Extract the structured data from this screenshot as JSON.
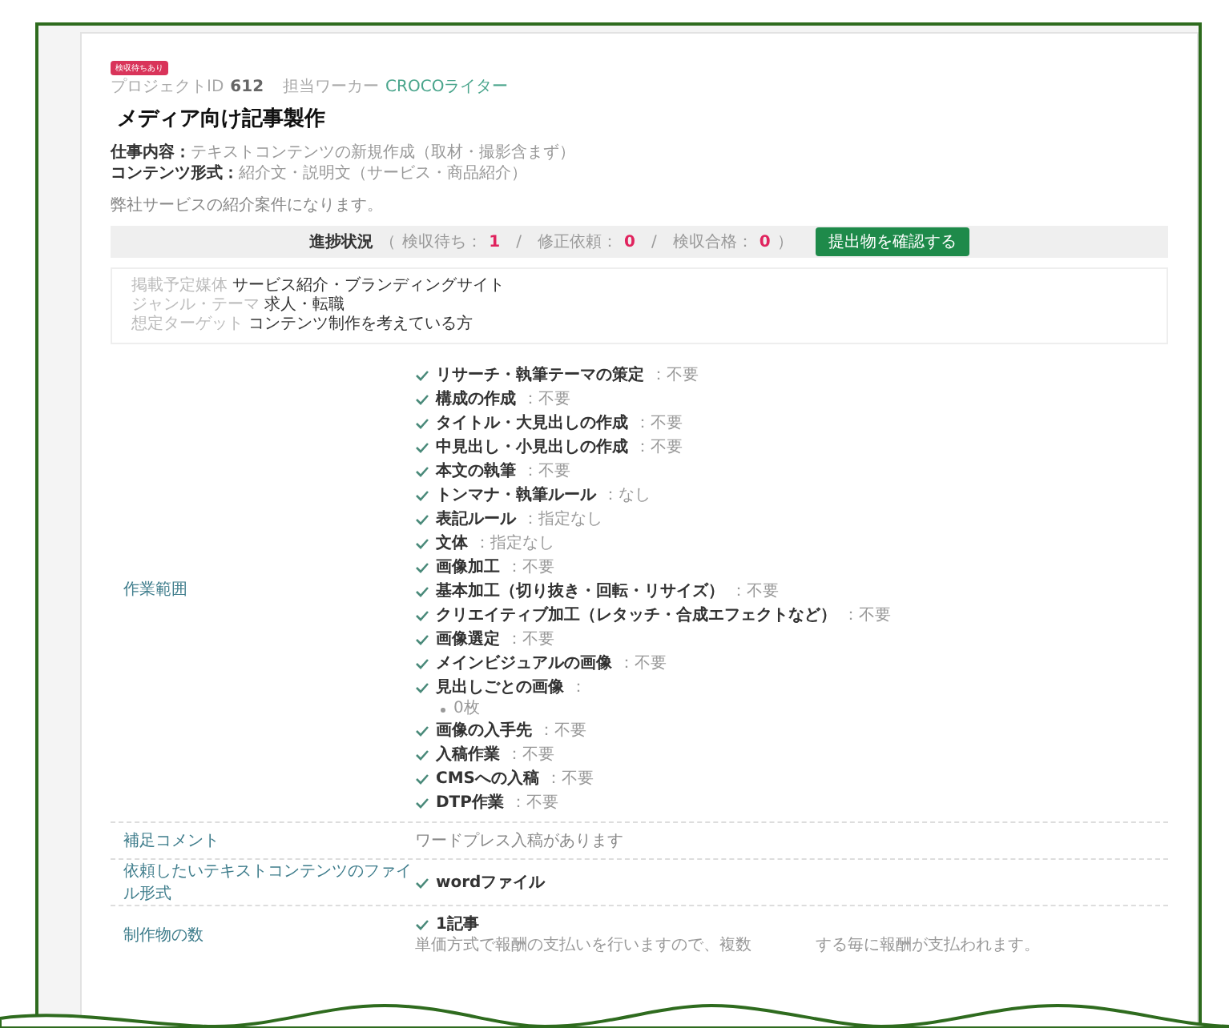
{
  "badge": "検収待ちあり",
  "project": {
    "id_label": "プロジェクトID",
    "id": "612",
    "worker_label": "担当ワーカー",
    "worker": "CROCOライター"
  },
  "title": "メディア向け記事製作",
  "summary": [
    {
      "label": "仕事内容：",
      "value": "テキストコンテンツの新規作成（取材・撮影含まず）"
    },
    {
      "label": "コンテンツ形式：",
      "value": "紹介文・説明文（サービス・商品紹介）"
    }
  ],
  "description": "弊社サービスの紹介案件になります。",
  "progress": {
    "label": "進捗状況",
    "open": "（",
    "close": "）",
    "separators": [
      "/",
      "/"
    ],
    "items": [
      {
        "label": "検収待ち：",
        "count": "1"
      },
      {
        "label": "修正依頼：",
        "count": "0"
      },
      {
        "label": "検収合格：",
        "count": "0"
      }
    ],
    "button": "提出物を確認する"
  },
  "info": [
    {
      "label": "掲載予定媒体",
      "value": "サービス紹介・ブランディングサイト"
    },
    {
      "label": "ジャンル・テーマ",
      "value": "求人・転職"
    },
    {
      "label": "想定ターゲット",
      "value": "コンテンツ制作を考えている方"
    }
  ],
  "rows": [
    {
      "label": "作業範囲",
      "kind": "checklist",
      "items": [
        {
          "name": "リサーチ・執筆テーマの策定",
          "value": "：不要"
        },
        {
          "name": "構成の作成",
          "value": "：不要"
        },
        {
          "name": "タイトル・大見出しの作成",
          "value": "：不要"
        },
        {
          "name": "中見出し・小見出しの作成",
          "value": "：不要"
        },
        {
          "name": "本文の執筆",
          "value": "：不要"
        },
        {
          "name": "トンマナ・執筆ルール",
          "value": "：なし"
        },
        {
          "name": "表記ルール",
          "value": "：指定なし"
        },
        {
          "name": "文体",
          "value": "：指定なし"
        },
        {
          "name": "画像加工",
          "value": "：不要"
        },
        {
          "name": "基本加工（切り抜き・回転・リサイズ）",
          "value": "：不要"
        },
        {
          "name": "クリエイティブ加工（レタッチ・合成エフェクトなど）",
          "value": "：不要"
        },
        {
          "name": "画像選定",
          "value": "：不要"
        },
        {
          "name": "メインビジュアルの画像",
          "value": "：不要"
        },
        {
          "name": "見出しごとの画像",
          "value": "：",
          "sub": [
            "0枚"
          ]
        },
        {
          "name": "画像の入手先",
          "value": "：不要"
        },
        {
          "name": "入稿作業",
          "value": "：不要"
        },
        {
          "name": "CMSへの入稿",
          "value": "：不要"
        },
        {
          "name": "DTP作業",
          "value": "：不要"
        }
      ]
    },
    {
      "label": "補足コメント",
      "kind": "text",
      "text": "ワードプレス入稿があります"
    },
    {
      "label": "依頼したいテキストコンテンツのファイル形式",
      "kind": "checklist",
      "items": [
        {
          "name": "wordファイル"
        }
      ]
    },
    {
      "label": "制作物の数",
      "kind": "checklist",
      "items": [
        {
          "name": "1記事"
        }
      ],
      "notes": [
        "単価方式で報酬の支払いを行いますので、複数",
        "する毎に報酬が支払われます。"
      ]
    }
  ]
}
